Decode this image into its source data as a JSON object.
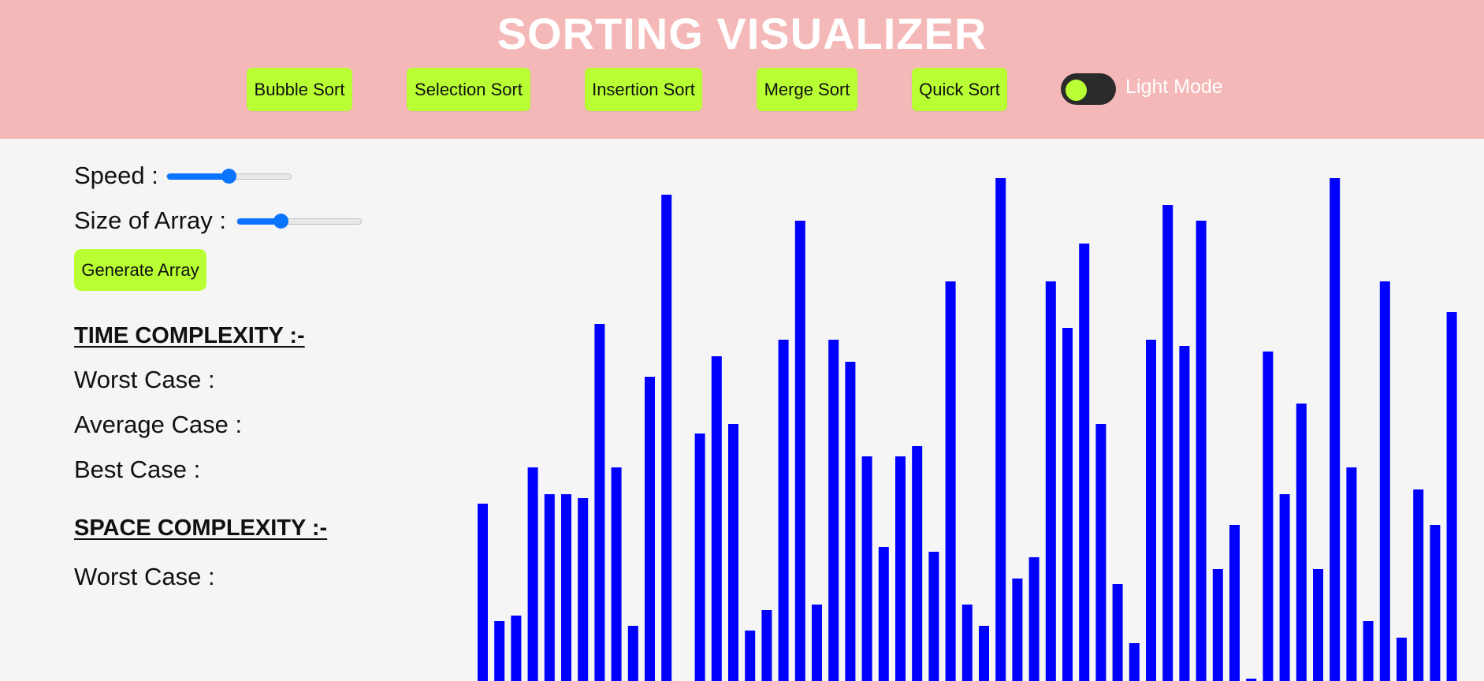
{
  "header": {
    "title": "SORTING VISUALIZER",
    "buttons": [
      "Bubble Sort",
      "Selection Sort",
      "Insertion Sort",
      "Merge Sort",
      "Quick Sort"
    ],
    "mode_toggle_label": "Light Mode"
  },
  "controls": {
    "speed_label": "Speed :",
    "speed_value": 0.5,
    "size_label": "Size of Array :",
    "size_value": 0.33,
    "generate_label": "Generate Array"
  },
  "complexity": {
    "time_heading": "TIME COMPLEXITY :-",
    "worst_case": "Worst Case :",
    "average_case": "Average Case :",
    "best_case": "Best Case :",
    "space_heading": "SPACE COMPLEXITY :-",
    "space_worst_case": "Worst Case :"
  },
  "colors": {
    "header_bg": "#f5b8b8",
    "button_bg": "#b8ff33",
    "bar_color": "#0000ff",
    "slider_accent": "#0b74ff"
  },
  "array_bars": [
    225,
    76,
    83,
    271,
    237,
    237,
    232,
    453,
    271,
    70,
    386,
    617,
    0,
    314,
    412,
    326,
    64,
    90,
    433,
    584,
    97,
    433,
    405,
    285,
    170,
    285,
    298,
    164,
    507,
    97,
    70,
    638,
    130,
    157,
    507,
    448,
    555,
    326,
    123,
    48,
    433,
    604,
    425,
    584,
    142,
    198,
    3,
    418,
    237,
    352,
    142,
    638,
    271,
    76,
    507,
    55,
    243,
    198,
    468
  ]
}
